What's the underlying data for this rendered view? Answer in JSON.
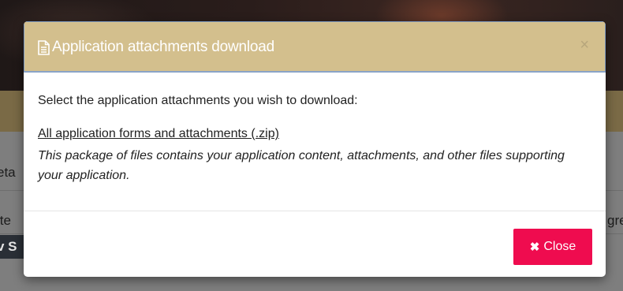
{
  "background": {
    "fragment_1": "eta",
    "fragment_2": "ite",
    "fragment_3": "gre",
    "fragment_4": "v S"
  },
  "modal": {
    "title": "Application attachments download",
    "title_icon": "document-icon",
    "close_symbol": "×",
    "intro_text": "Select the application attachments you wish to download:",
    "file_link_text": "All application forms and attachments (.zip)",
    "file_description": "This package of files contains your application content, attachments, and other files supporting your application.",
    "close_button": {
      "icon_symbol": "✖",
      "label": "Close"
    }
  },
  "colors": {
    "header_bg": "#d3bf8d",
    "header_border": "#7f9bc1",
    "close_button_bg": "#ef0c4f",
    "overlay_bg": "#7e7e7e"
  }
}
